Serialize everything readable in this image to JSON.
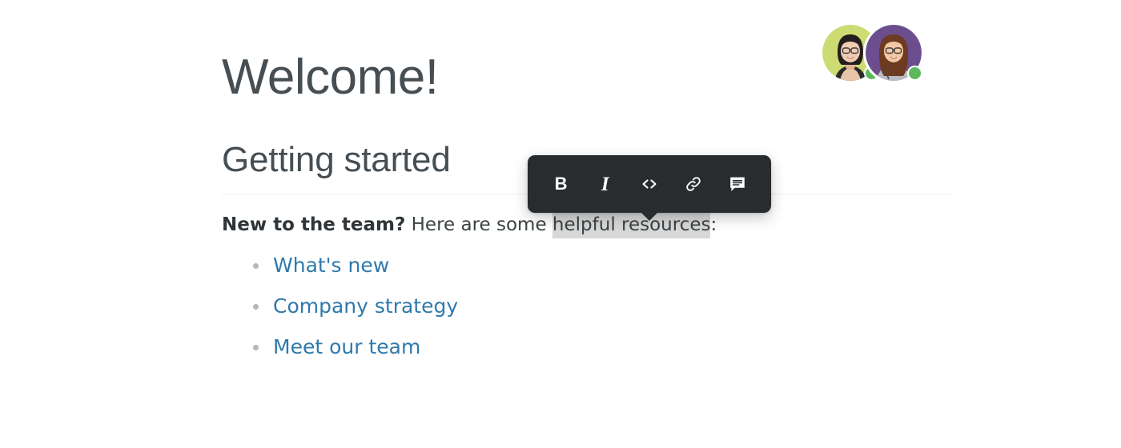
{
  "colors": {
    "heading": "#464e53",
    "body_text": "#3b4245",
    "link": "#2f7aab",
    "selection_highlight": "#d8d8d8",
    "toolbar_bg": "#282c2f",
    "toolbar_icon": "#ffffff",
    "bullet": "#b7b7b7",
    "rule": "#ececec",
    "status_online": "#5bb85b",
    "avatar_one_bg": "#cddc72",
    "avatar_two_bg": "#6c4e8f",
    "page_bg": "#ffffff"
  },
  "presence": {
    "avatars": [
      {
        "name": "avatar-user-one",
        "background": "#cddc72",
        "status": "online"
      },
      {
        "name": "avatar-user-two",
        "background": "#6c4e8f",
        "status": "online"
      }
    ]
  },
  "document": {
    "title": "Welcome!",
    "section_heading": "Getting started",
    "paragraph": {
      "lead": "New to the team?",
      "middle": " Here are some ",
      "selected": "helpful resources",
      "trailing": ":"
    },
    "links": [
      {
        "label": "What's new"
      },
      {
        "label": "Company strategy"
      },
      {
        "label": "Meet our team"
      }
    ]
  },
  "format_toolbar": {
    "buttons": [
      {
        "name": "bold-button",
        "icon": "bold-icon",
        "label": "B",
        "title": "Bold"
      },
      {
        "name": "italic-button",
        "icon": "italic-icon",
        "label": "I",
        "title": "Italic"
      },
      {
        "name": "code-button",
        "icon": "code-icon",
        "label": "<>",
        "title": "Code"
      },
      {
        "name": "link-button",
        "icon": "link-icon",
        "label": "",
        "title": "Link"
      },
      {
        "name": "comment-button",
        "icon": "comment-icon",
        "label": "",
        "title": "Comment"
      }
    ]
  }
}
